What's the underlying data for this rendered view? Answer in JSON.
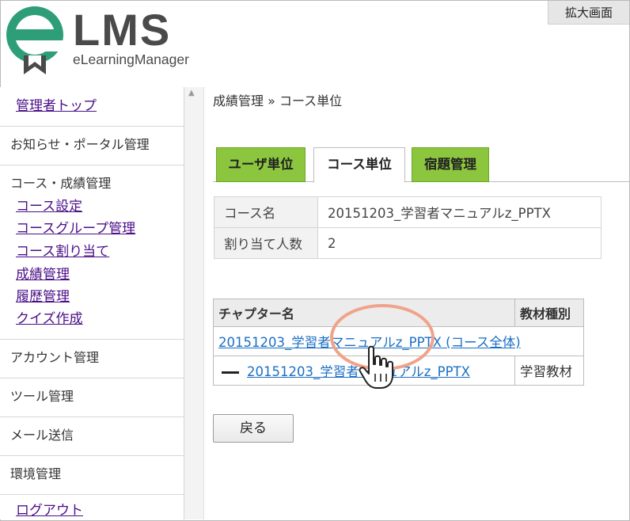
{
  "zoom_badge": "拡大画面",
  "logo": {
    "brand": "LMS",
    "sub": "eLearningManager",
    "accent_color": "#2e9e78"
  },
  "sidebar": {
    "admin_top": "管理者トップ",
    "notice_portal": "お知らせ・ポータル管理",
    "course_grade_head": "コース・成績管理",
    "course_settings": "コース設定",
    "course_group": "コースグループ管理",
    "course_assign": "コース割り当て",
    "grade_manage": "成績管理",
    "history_manage": "履歴管理",
    "quiz_create": "クイズ作成",
    "account_manage": "アカウント管理",
    "tool_manage": "ツール管理",
    "mail_send": "メール送信",
    "env_manage": "環境管理",
    "logout": "ログアウト"
  },
  "breadcrumb": "成績管理 » コース単位",
  "tabs": {
    "user_unit": "ユーザ単位",
    "course_unit": "コース単位",
    "assignment_manage": "宿題管理",
    "active_color": "#ffffff",
    "green_color": "#8cc63f"
  },
  "course_info": {
    "name_label": "コース名",
    "name_value": "20151203_学習者マニュアルz_PPTX",
    "assign_label": "割り当て人数",
    "assign_value": "2"
  },
  "chapter_table": {
    "col_chapter": "チャプター名",
    "col_type": "教材種別",
    "row1_link": "20151203_学習者マニュアルz_PPTX (コース全体)",
    "row2_link": "20151203_学習者マニュアルz_PPTX",
    "row2_type": "学習教材"
  },
  "back_button": "戻る",
  "link_color": "#1b6fc4",
  "highlight_color": "#f0a38a"
}
